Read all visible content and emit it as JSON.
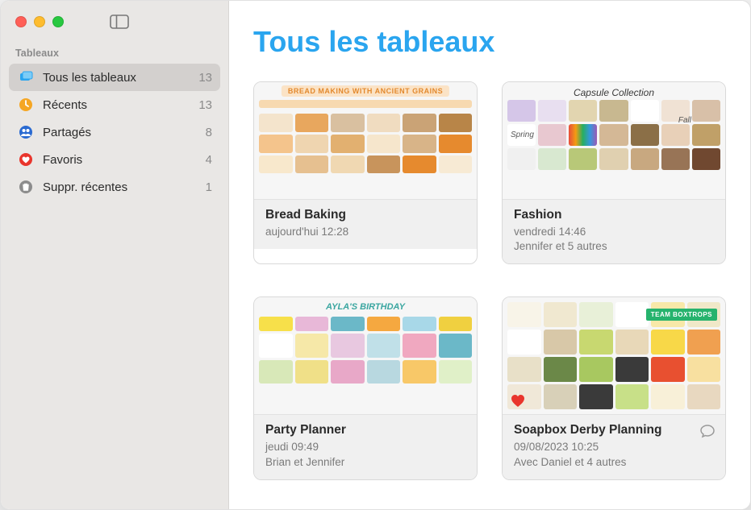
{
  "sidebar": {
    "section_label": "Tableaux",
    "items": [
      {
        "id": "all",
        "label": "Tous les tableaux",
        "count": "13",
        "icon": "board",
        "color": "#2aa5ef",
        "selected": true
      },
      {
        "id": "recents",
        "label": "Récents",
        "count": "13",
        "icon": "clock",
        "color": "#f5a623",
        "selected": false
      },
      {
        "id": "shared",
        "label": "Partagés",
        "count": "8",
        "icon": "people",
        "color": "#2a6ad1",
        "selected": false
      },
      {
        "id": "favorites",
        "label": "Favoris",
        "count": "4",
        "icon": "heart",
        "color": "#e9352c",
        "selected": false
      },
      {
        "id": "trash",
        "label": "Suppr. récentes",
        "count": "1",
        "icon": "trash",
        "color": "#8c8c8c",
        "selected": false
      }
    ]
  },
  "main": {
    "title": "Tous les tableaux",
    "boards": [
      {
        "title": "Bread Baking",
        "date": "aujourd'hui 12:28",
        "people": "",
        "thumb_banner": "BREAD MAKING WITH ANCIENT GRAINS",
        "favorite": false,
        "has_chat": false
      },
      {
        "title": "Fashion",
        "date": "vendredi 14:46",
        "people": "Jennifer et 5 autres",
        "thumb_banner": "Capsule Collection",
        "thumb_left_label": "Spring",
        "thumb_right_label": "Fall",
        "favorite": false,
        "has_chat": false
      },
      {
        "title": "Party Planner",
        "date": "jeudi 09:49",
        "people": "Brian et Jennifer",
        "thumb_banner": "AYLA'S BIRTHDAY",
        "favorite": false,
        "has_chat": false
      },
      {
        "title": "Soapbox Derby Planning",
        "date": "09/08/2023 10:25",
        "people": "Avec Daniel et 4 autres",
        "thumb_banner": "TEAM BOXTROPS",
        "favorite": true,
        "has_chat": true
      }
    ]
  }
}
